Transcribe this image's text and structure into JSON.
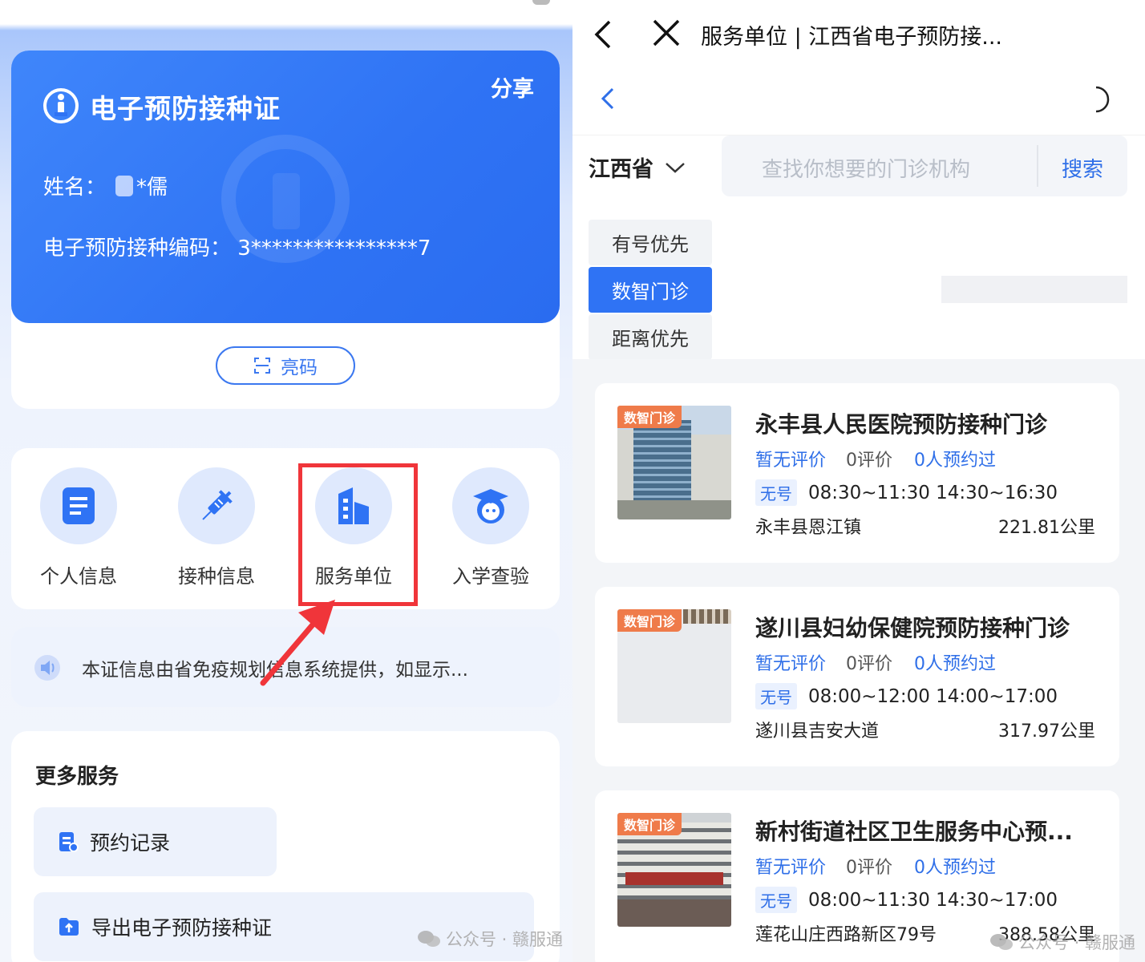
{
  "left": {
    "certificate": {
      "title": "电子预防接种证",
      "share_label": "分享",
      "name_label": "姓名：",
      "name_value": "*儒",
      "code_label": "电子预防接种编码：",
      "code_value": "3****************7",
      "bright_code_label": "亮码"
    },
    "functions": [
      {
        "label": "个人信息",
        "icon": "document-icon"
      },
      {
        "label": "接种信息",
        "icon": "syringe-icon"
      },
      {
        "label": "服务单位",
        "icon": "building-icon"
      },
      {
        "label": "入学查验",
        "icon": "graduate-icon"
      }
    ],
    "notice_text": "本证信息由省免疫规划信息系统提供，如显示...",
    "more_services": {
      "title": "更多服务",
      "items": [
        {
          "label": "预约记录",
          "icon": "record-icon"
        },
        {
          "label": "导出电子预防接种证",
          "icon": "export-icon"
        }
      ]
    },
    "watermark": "公众号 · 赣服通"
  },
  "right": {
    "page_title": "服务单位 | 江西省电子预防接...",
    "province": "江西省",
    "search_placeholder": "查找你想要的门诊机构",
    "search_button": "搜索",
    "sort_tabs": [
      {
        "label": "有号优先",
        "active": false
      },
      {
        "label": "数智门诊",
        "active": true
      },
      {
        "label": "距离优先",
        "active": false
      }
    ],
    "clinics": [
      {
        "badge": "数智门诊",
        "name": "永丰县人民医院预防接种门诊",
        "no_rating": "暂无评价",
        "reviews": "0评价",
        "booked": "0人预约过",
        "slot_tag": "无号",
        "hours": "08:30~11:30 14:30~16:30",
        "address": "永丰县恩江镇",
        "distance": "221.81公里"
      },
      {
        "badge": "数智门诊",
        "name": "遂川县妇幼保健院预防接种门诊",
        "no_rating": "暂无评价",
        "reviews": "0评价",
        "booked": "0人预约过",
        "slot_tag": "无号",
        "hours": "08:00~12:00 14:00~17:00",
        "address": "遂川县吉安大道",
        "distance": "317.97公里"
      },
      {
        "badge": "数智门诊",
        "name": "新村街道社区卫生服务中心预...",
        "no_rating": "暂无评价",
        "reviews": "0评价",
        "booked": "0人预约过",
        "slot_tag": "无号",
        "hours": "08:00~11:30 14:30~17:00",
        "address": "莲花山庄西路新区79号",
        "distance": "388.58公里"
      }
    ],
    "watermark": "公众号 · 赣服通"
  },
  "colors": {
    "primary": "#2f73f4",
    "highlight_red": "#f0353a",
    "badge_orange": "#ef7b4a"
  }
}
